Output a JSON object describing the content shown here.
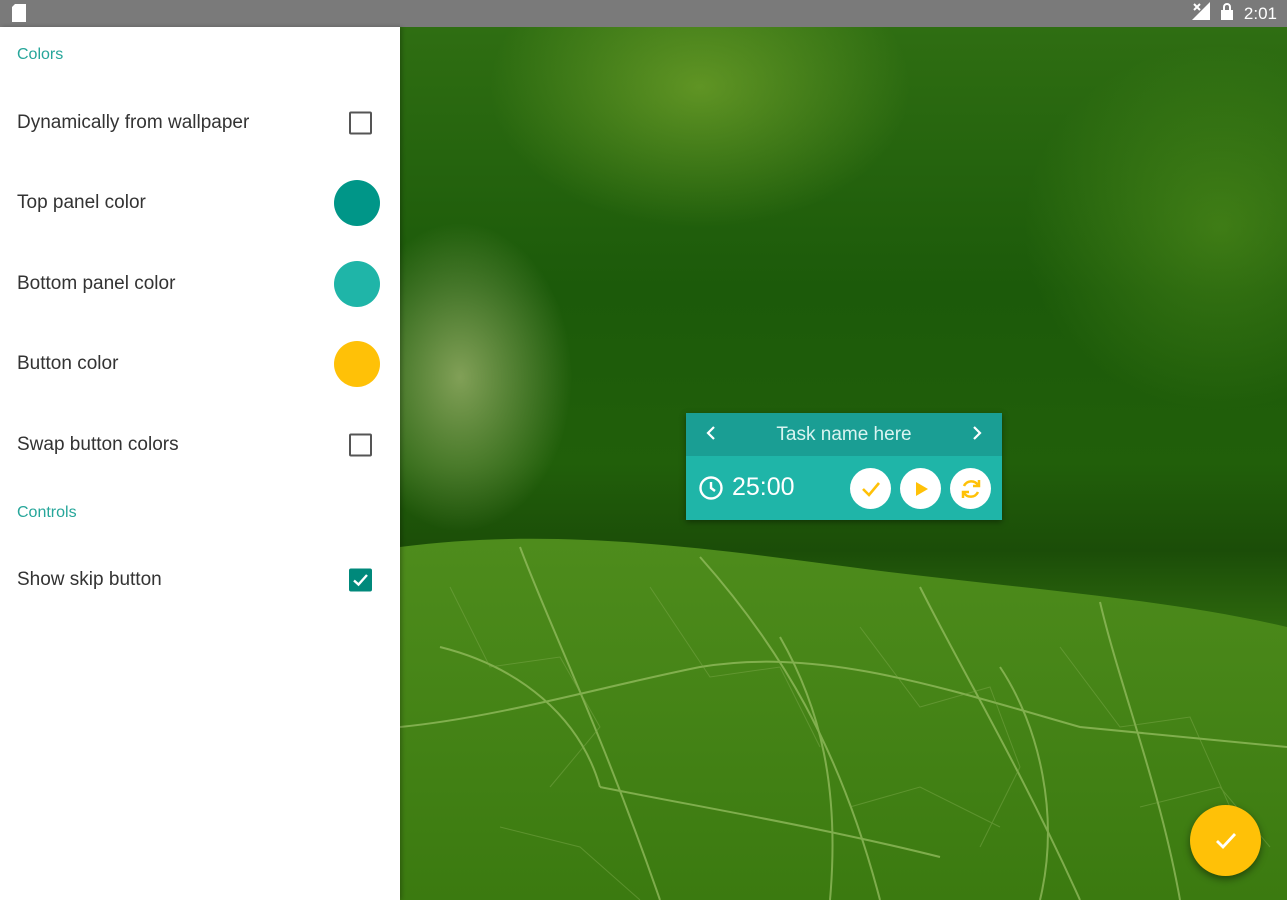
{
  "status_bar": {
    "time": "2:01",
    "left_icon": "sd-card-icon",
    "right_icons": [
      "signal-icon",
      "lock-icon"
    ]
  },
  "settings": {
    "colors_header": "Colors",
    "dynamic_wallpaper": {
      "label": "Dynamically from wallpaper",
      "checked": false
    },
    "top_panel_color": {
      "label": "Top panel color",
      "color": "#009688"
    },
    "bottom_panel_color": {
      "label": "Bottom panel color",
      "color": "#1fb5a8"
    },
    "button_color": {
      "label": "Button color",
      "color": "#ffc107"
    },
    "swap_button_colors": {
      "label": "Swap button colors",
      "checked": false
    },
    "controls_header": "Controls",
    "show_skip_button": {
      "label": "Show skip button",
      "checked": true
    }
  },
  "widget": {
    "task_name": "Task name here",
    "timer": "25:00",
    "top_color": "#1a9e94",
    "bottom_color": "#1fb5a8"
  },
  "fab": {
    "icon": "check-icon",
    "color": "#ffc107"
  }
}
